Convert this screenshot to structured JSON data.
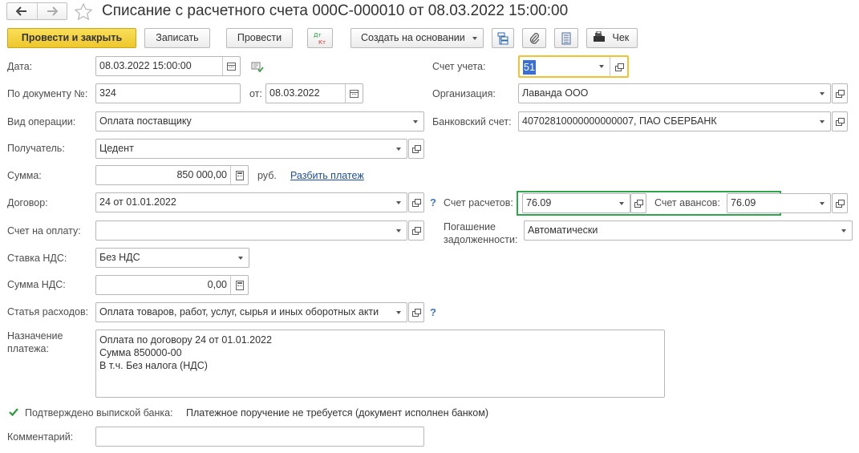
{
  "window": {
    "title": "Списание с расчетного счета 000С-000010 от 08.03.2022 15:00:00"
  },
  "toolbar": {
    "post_close": "Провести и закрыть",
    "save": "Записать",
    "post": "Провести",
    "dt_kt_top": "Дт",
    "dt_kt_bottom": "Кт",
    "create_based": "Создать на основании",
    "check": "Чек"
  },
  "form": {
    "date_label": "Дата:",
    "date_value": "08.03.2022 15:00:00",
    "doc_num_label": "По документу №:",
    "doc_num_value": "324",
    "from_label": "от:",
    "from_value": "08.03.2022",
    "op_type_label": "Вид операции:",
    "op_type_value": "Оплата поставщику",
    "recipient_label": "Получатель:",
    "recipient_value": "Цедент",
    "amount_label": "Сумма:",
    "amount_value": "850 000,00",
    "currency": "руб.",
    "split_link": "Разбить платеж",
    "contract_label": "Договор:",
    "contract_value": "24 от 01.01.2022",
    "invoice_label": "Счет на оплату:",
    "invoice_value": "",
    "vat_rate_label": "Ставка НДС:",
    "vat_rate_value": "Без НДС",
    "vat_amount_label": "Сумма НДС:",
    "vat_amount_value": "0,00",
    "expense_label": "Статья расходов:",
    "expense_value": "Оплата товаров, работ, услуг, сырья и иных оборотных акти",
    "purpose_label_1": "Назначение",
    "purpose_label_2": "платежа:",
    "purpose_line_1": "Оплата по договору 24 от 01.01.2022",
    "purpose_line_2": "Сумма 850000-00",
    "purpose_line_3": "В т.ч. Без налога (НДС)",
    "confirmed_label": "Подтверждено выпиской банка:",
    "confirmed_checked": true,
    "confirmed_note": "Платежное поручение не требуется (документ исполнен банком)",
    "comment_label": "Комментарий:",
    "comment_value": "",
    "help": "?"
  },
  "right": {
    "account_label": "Счет учета:",
    "account_value": "51",
    "org_label": "Организация:",
    "org_value": "Лаванда ООО",
    "bank_label": "Банковский счет:",
    "bank_value": "40702810000000000007, ПАО СБЕРБАНК",
    "settle_label": "Счет расчетов:",
    "settle_value": "76.09",
    "advance_label": "Счет авансов:",
    "advance_value": "76.09",
    "debt_label_1": "Погашение",
    "debt_label_2": "задолженности:",
    "debt_value": "Автоматически"
  },
  "colors": {
    "primary_button": "#f5d33a",
    "highlight_yellow": "#f2c230",
    "highlight_green": "#2aa84a",
    "link": "#1a4fa0"
  }
}
